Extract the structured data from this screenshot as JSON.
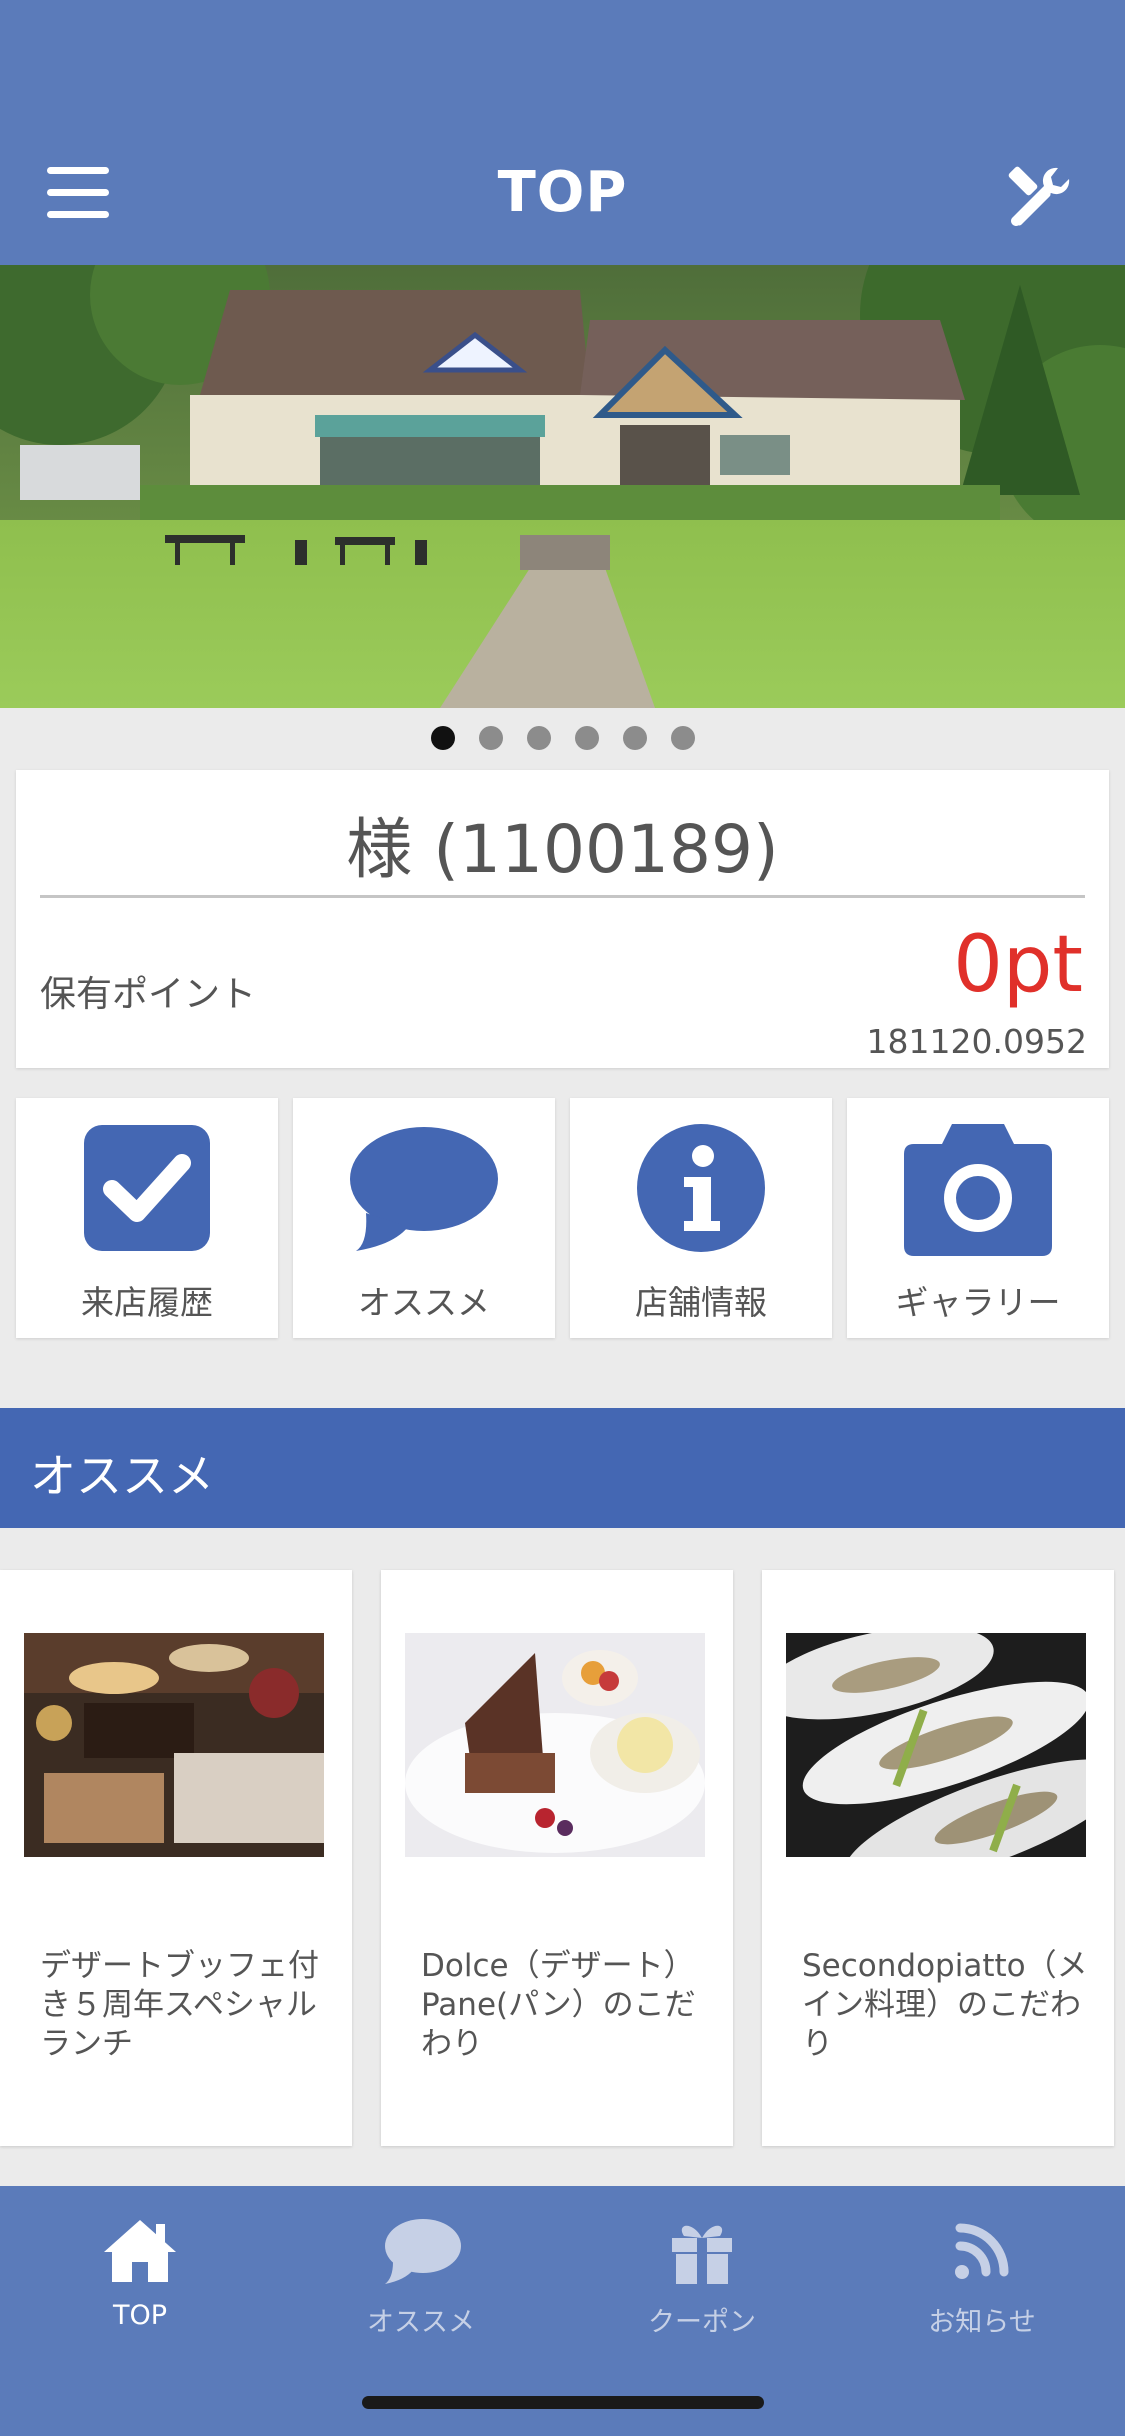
{
  "header": {
    "title": "TOP",
    "menu_icon": "hamburger-menu-icon",
    "tools_icon": "tools-icon",
    "background_color": "#5b7bba"
  },
  "hero": {
    "image": "garden-restaurant-building-photo",
    "slide_count": 6,
    "active_slide": 1
  },
  "member": {
    "name": "様 (1100189)",
    "points_label": "保有ポイント",
    "points_value": "0pt",
    "date": "181120.0952",
    "points_color": "#e0302a"
  },
  "tiles": [
    {
      "label": "来店履歴",
      "icon": "checkbox-check-icon"
    },
    {
      "label": "オススメ",
      "icon": "speech-bubble-icon"
    },
    {
      "label": "店舗情報",
      "icon": "info-icon"
    },
    {
      "label": "ギャラリー",
      "icon": "camera-icon"
    }
  ],
  "recommend": {
    "title": "オススメ",
    "bar_color": "#4467b3",
    "items": [
      {
        "text": "デザートブッフェ付き５周年スペシャルランチ",
        "image": "dessert-buffet-photo"
      },
      {
        "text": "Dolce（デザート）Pane(パン）のこだわり",
        "image": "dessert-plate-photo"
      },
      {
        "text": "Secondopiatto（メイン料理）のこだわり",
        "image": "main-dish-photo"
      }
    ]
  },
  "bottom_nav": {
    "items": [
      {
        "label": "TOP",
        "icon": "home-icon",
        "active": true
      },
      {
        "label": "オススメ",
        "icon": "speech-bubble-icon",
        "active": false
      },
      {
        "label": "クーポン",
        "icon": "gift-icon",
        "active": false
      },
      {
        "label": "お知らせ",
        "icon": "rss-icon",
        "active": false
      }
    ]
  },
  "icon_color": "#4467b3"
}
